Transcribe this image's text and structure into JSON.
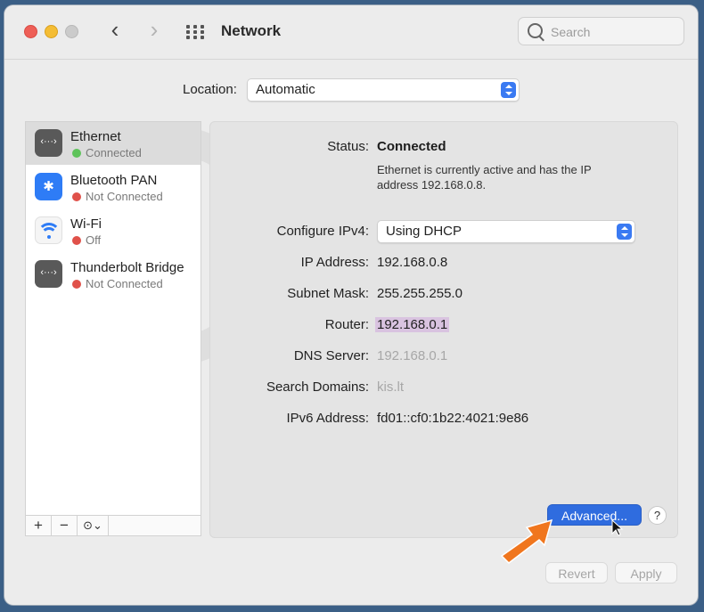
{
  "window": {
    "title": "Network",
    "search": {
      "placeholder": "Search"
    },
    "nav": {
      "back": "‹",
      "forward": "›"
    }
  },
  "location": {
    "label": "Location:",
    "value": "Automatic"
  },
  "services": [
    {
      "name": "Ethernet",
      "status": "Connected",
      "status_color": "#5ec35a",
      "icon": "ethernet-icon",
      "selected": true
    },
    {
      "name": "Bluetooth PAN",
      "status": "Not Connected",
      "status_color": "#e0514a",
      "icon": "bluetooth-icon",
      "selected": false
    },
    {
      "name": "Wi-Fi",
      "status": "Off",
      "status_color": "#e0514a",
      "icon": "wifi-icon",
      "selected": false
    },
    {
      "name": "Thunderbolt Bridge",
      "status": "Not Connected",
      "status_color": "#e0514a",
      "icon": "thunderbolt-bridge-icon",
      "selected": false
    }
  ],
  "sidebar_tools": {
    "add": "+",
    "remove": "−",
    "action": "⊙⌄"
  },
  "detail": {
    "status_label": "Status:",
    "status_value": "Connected",
    "status_description": "Ethernet is currently active and has the IP address 192.168.0.8.",
    "configure_label": "Configure IPv4:",
    "configure_value": "Using DHCP",
    "ip_label": "IP Address:",
    "ip_value": "192.168.0.8",
    "subnet_label": "Subnet Mask:",
    "subnet_value": "255.255.255.0",
    "router_label": "Router:",
    "router_value": "192.168.0.1",
    "dns_label": "DNS Server:",
    "dns_value": "192.168.0.1",
    "domains_label": "Search Domains:",
    "domains_value": "kis.lt",
    "ipv6_label": "IPv6 Address:",
    "ipv6_value": "fd01::cf0:1b22:4021:9e86"
  },
  "buttons": {
    "advanced": "Advanced...",
    "help": "?",
    "revert": "Revert",
    "apply": "Apply"
  },
  "colors": {
    "accent": "#2f6cdf",
    "highlight": "#d9c3e0",
    "arrow": "#f0761e"
  }
}
